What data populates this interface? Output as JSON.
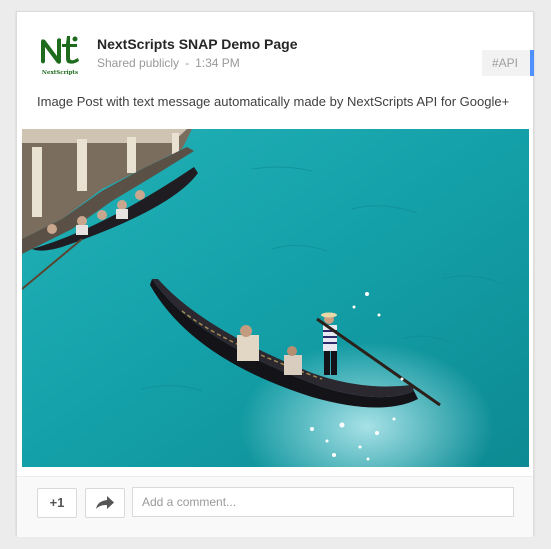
{
  "post": {
    "author": "NextScripts SNAP Demo Page",
    "visibility": "Shared publicly",
    "separator": "-",
    "time": "1:34 PM",
    "hashtag": "#API",
    "message": "Image Post with text message automatically made by NextScripts API for Google+",
    "avatar_logo_text": "NextScripts"
  },
  "actions": {
    "plus_one_label": "+1",
    "share_icon": "share-arrow-icon",
    "comment_placeholder": "Add a comment..."
  },
  "colors": {
    "accent_blue": "#4d90fe",
    "water": "#1aa3ad",
    "avatar_green": "#1e6b1e"
  }
}
